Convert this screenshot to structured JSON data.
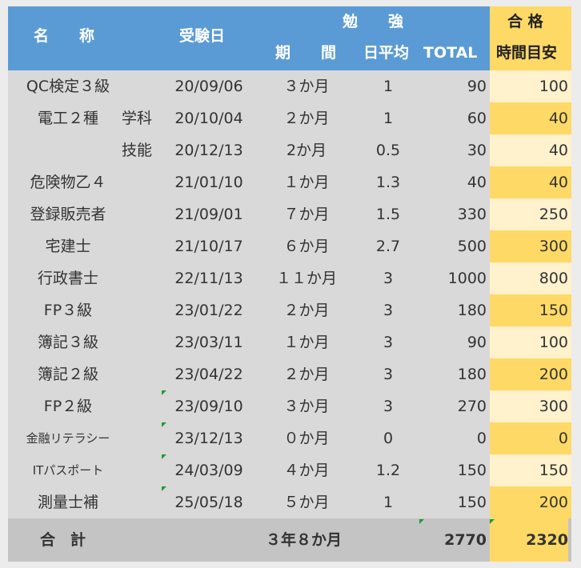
{
  "header": {
    "name": "名　　称",
    "exam_date": "受験日",
    "study": "勉　　強",
    "period": "期　　間",
    "daily_avg": "日平均",
    "total": "TOTAL",
    "pass_top": "合 格",
    "pass_bottom": "時間目安"
  },
  "rows": [
    {
      "name": "QC検定３級",
      "sub": "",
      "date": "20/09/06",
      "period": "３か月",
      "avg": "1",
      "total": "90",
      "target": "100"
    },
    {
      "name": "電工２種",
      "sub": "学科",
      "date": "20/10/04",
      "period": "２か月",
      "avg": "1",
      "total": "60",
      "target": "40"
    },
    {
      "name": "",
      "sub": "技能",
      "date": "20/12/13",
      "period": "2か月",
      "avg": "0.5",
      "total": "30",
      "target": "40"
    },
    {
      "name": "危険物乙４",
      "sub": "",
      "date": "21/01/10",
      "period": "１か月",
      "avg": "1.3",
      "total": "40",
      "target": "40"
    },
    {
      "name": "登録販売者",
      "sub": "",
      "date": "21/09/01",
      "period": "７か月",
      "avg": "1.5",
      "total": "330",
      "target": "250"
    },
    {
      "name": "宅建士",
      "sub": "",
      "date": "21/10/17",
      "period": "６か月",
      "avg": "2.7",
      "total": "500",
      "target": "300"
    },
    {
      "name": "行政書士",
      "sub": "",
      "date": "22/11/13",
      "period": "１１か月",
      "avg": "3",
      "total": "1000",
      "target": "800"
    },
    {
      "name": "FP３級",
      "sub": "",
      "date": "23/01/22",
      "period": "２か月",
      "avg": "3",
      "total": "180",
      "target": "150"
    },
    {
      "name": "簿記３級",
      "sub": "",
      "date": "23/03/11",
      "period": "１か月",
      "avg": "3",
      "total": "90",
      "target": "100"
    },
    {
      "name": "簿記２級",
      "sub": "",
      "date": "23/04/22",
      "period": "２か月",
      "avg": "3",
      "total": "180",
      "target": "200"
    },
    {
      "name": "FP２級",
      "sub": "",
      "date": "23/09/10",
      "period": "３か月",
      "avg": "3",
      "total": "270",
      "target": "300"
    },
    {
      "name": "金融リテラシー",
      "sub": "",
      "date": "23/12/13",
      "period": "０か月",
      "avg": "0",
      "total": "0",
      "target": "0"
    },
    {
      "name": "ITパスポート",
      "sub": "",
      "date": "24/03/09",
      "period": "４か月",
      "avg": "1.2",
      "total": "150",
      "target": "150"
    },
    {
      "name": "測量士補",
      "sub": "",
      "date": "25/05/18",
      "period": "５か月",
      "avg": "1",
      "total": "150",
      "target": "200"
    }
  ],
  "footer": {
    "label": "合　計",
    "period": "３年８か月",
    "total": "2770",
    "target": "2320"
  },
  "colors": {
    "header_blue": "#5b9bd5",
    "header_gold": "#ffd966",
    "light_gold": "#fff2cc",
    "body_gray": "#d9d9d9",
    "total_gray": "#c4c4c4",
    "comment_marker": "#1e9b3c"
  }
}
